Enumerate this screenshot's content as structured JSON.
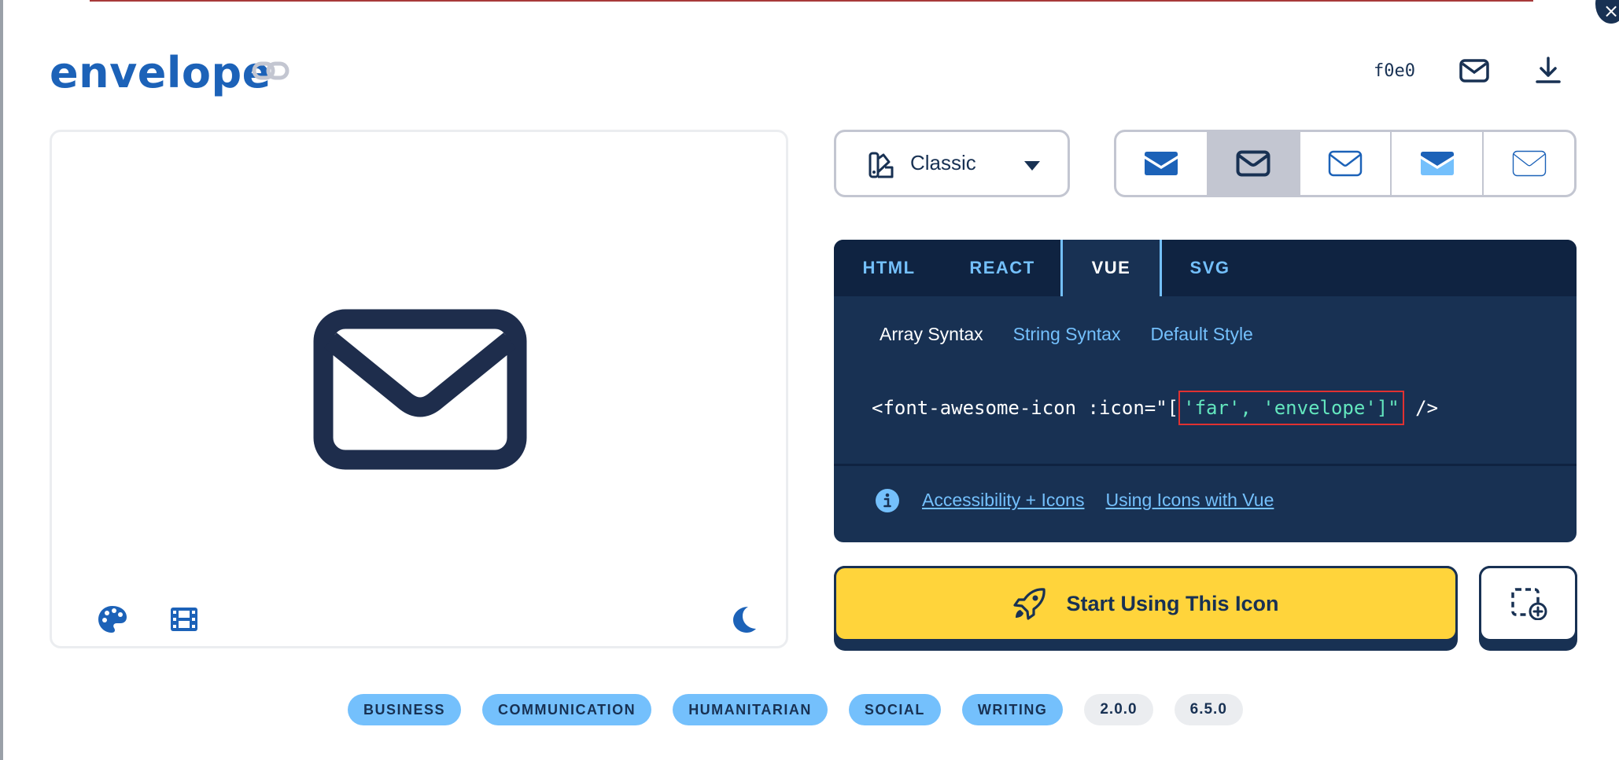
{
  "icon": {
    "name": "envelope",
    "unicode": "f0e0"
  },
  "colors": {
    "brand_blue": "#1c62b8",
    "navy": "#183153",
    "light_blue": "#74c0fc",
    "yellow": "#ffd43b",
    "teal": "#63e6be"
  },
  "style_select": {
    "label": "Classic"
  },
  "variants": [
    {
      "name": "solid",
      "active": false
    },
    {
      "name": "regular",
      "active": true
    },
    {
      "name": "light",
      "active": false
    },
    {
      "name": "duotone",
      "active": false
    },
    {
      "name": "thin",
      "active": false
    }
  ],
  "code": {
    "tabs": [
      "HTML",
      "REACT",
      "VUE",
      "SVG"
    ],
    "active_tab": "VUE",
    "subtabs": [
      "Array Syntax",
      "String Syntax",
      "Default Style"
    ],
    "active_subtab": "Array Syntax",
    "line_prefix": "<font-awesome-icon :icon=\"[",
    "line_highlight": "'far', 'envelope']\"",
    "line_suffix": " />",
    "links": [
      "Accessibility + Icons",
      "Using Icons with Vue"
    ]
  },
  "start_button": {
    "label": "Start Using This Icon"
  },
  "tags": {
    "categories": [
      "BUSINESS",
      "COMMUNICATION",
      "HUMANITARIAN",
      "SOCIAL",
      "WRITING"
    ],
    "versions": [
      "2.0.0",
      "6.5.0"
    ]
  }
}
